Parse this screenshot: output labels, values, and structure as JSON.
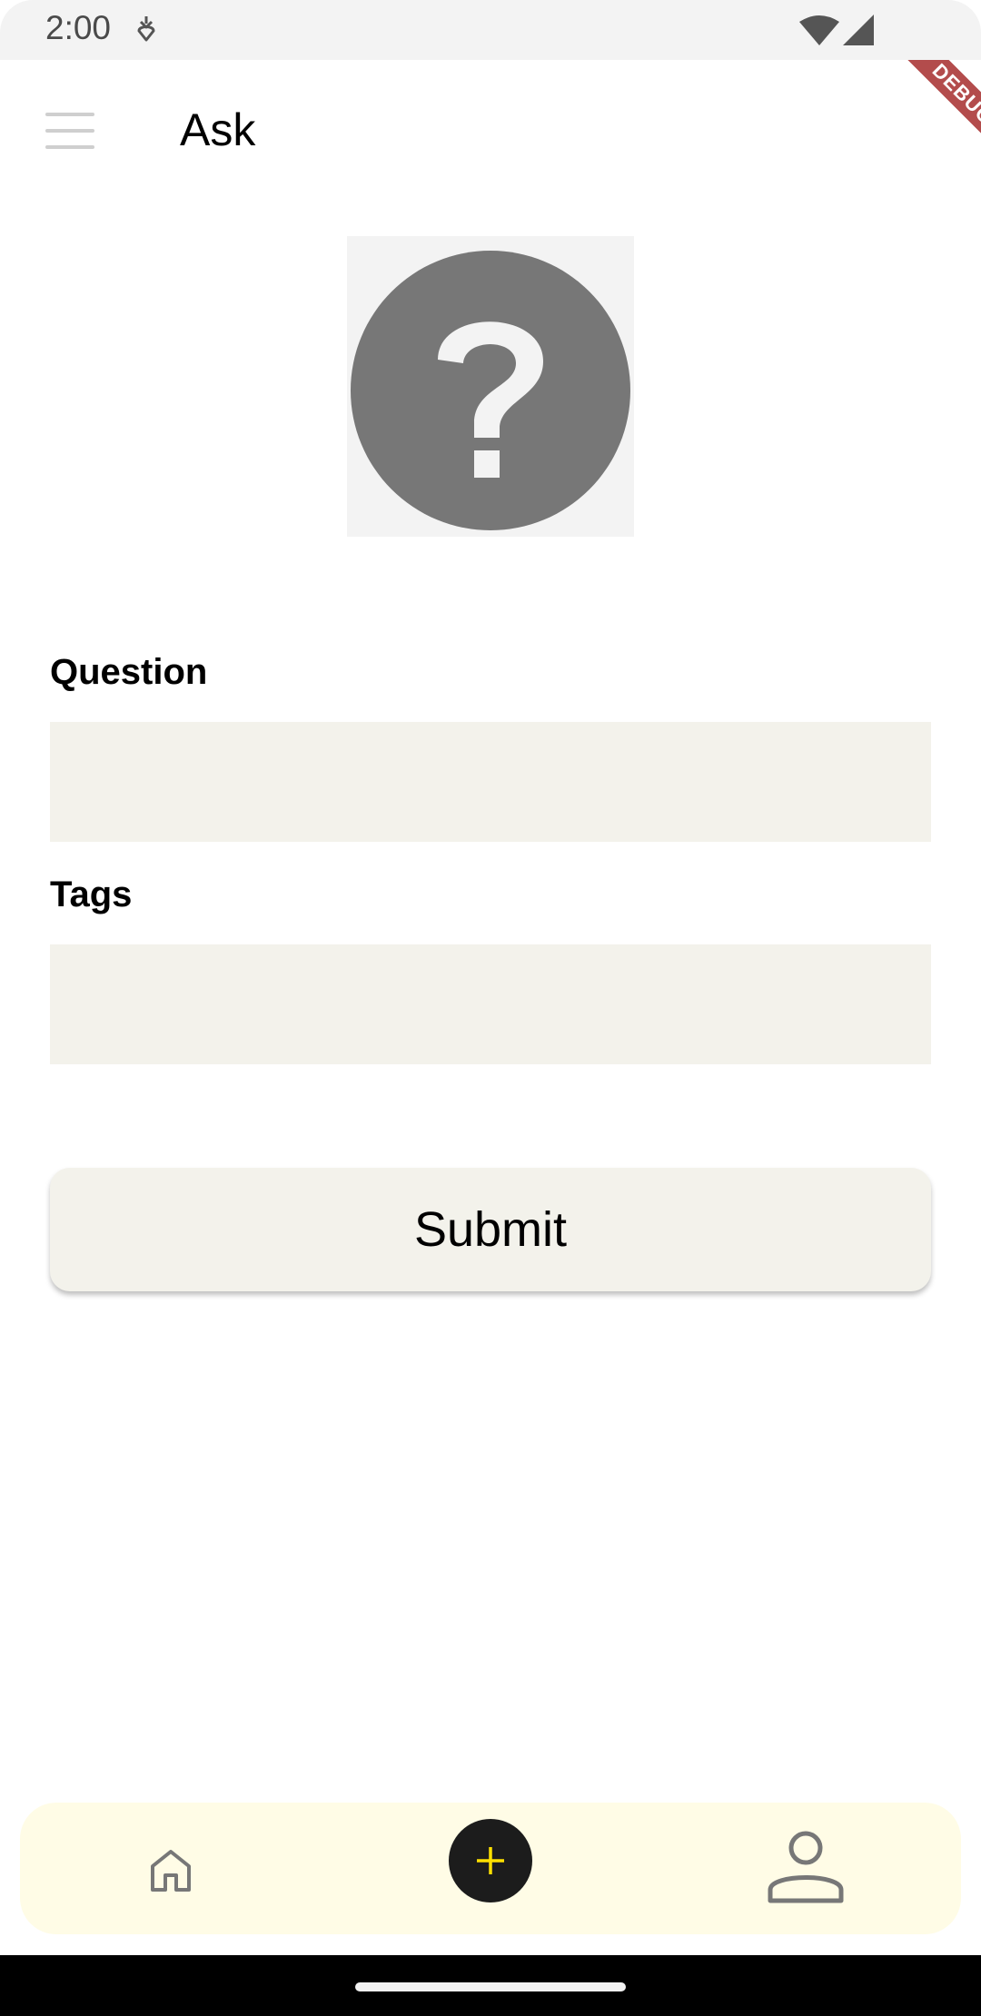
{
  "status_bar": {
    "time": "2:00",
    "icons": [
      "data-saver-icon",
      "wifi-icon",
      "cell-signal-icon"
    ]
  },
  "app_bar": {
    "title": "Ask",
    "menu_icon": "hamburger-menu-icon",
    "debug_banner": "DEBUG"
  },
  "question_image": {
    "icon": "help-circle-icon",
    "circle_color": "#777777",
    "background_color": "#f3f3f3"
  },
  "form": {
    "question_label": "Question",
    "question_value": "",
    "tags_label": "Tags",
    "tags_value": "",
    "submit_label": "Submit",
    "input_color": "#f3f2eb"
  },
  "bottom_nav": {
    "background_color": "#fffce6",
    "items": [
      {
        "icon": "home-icon"
      },
      {
        "icon": "add-icon",
        "accent": "#ffe000"
      },
      {
        "icon": "profile-icon"
      }
    ]
  }
}
